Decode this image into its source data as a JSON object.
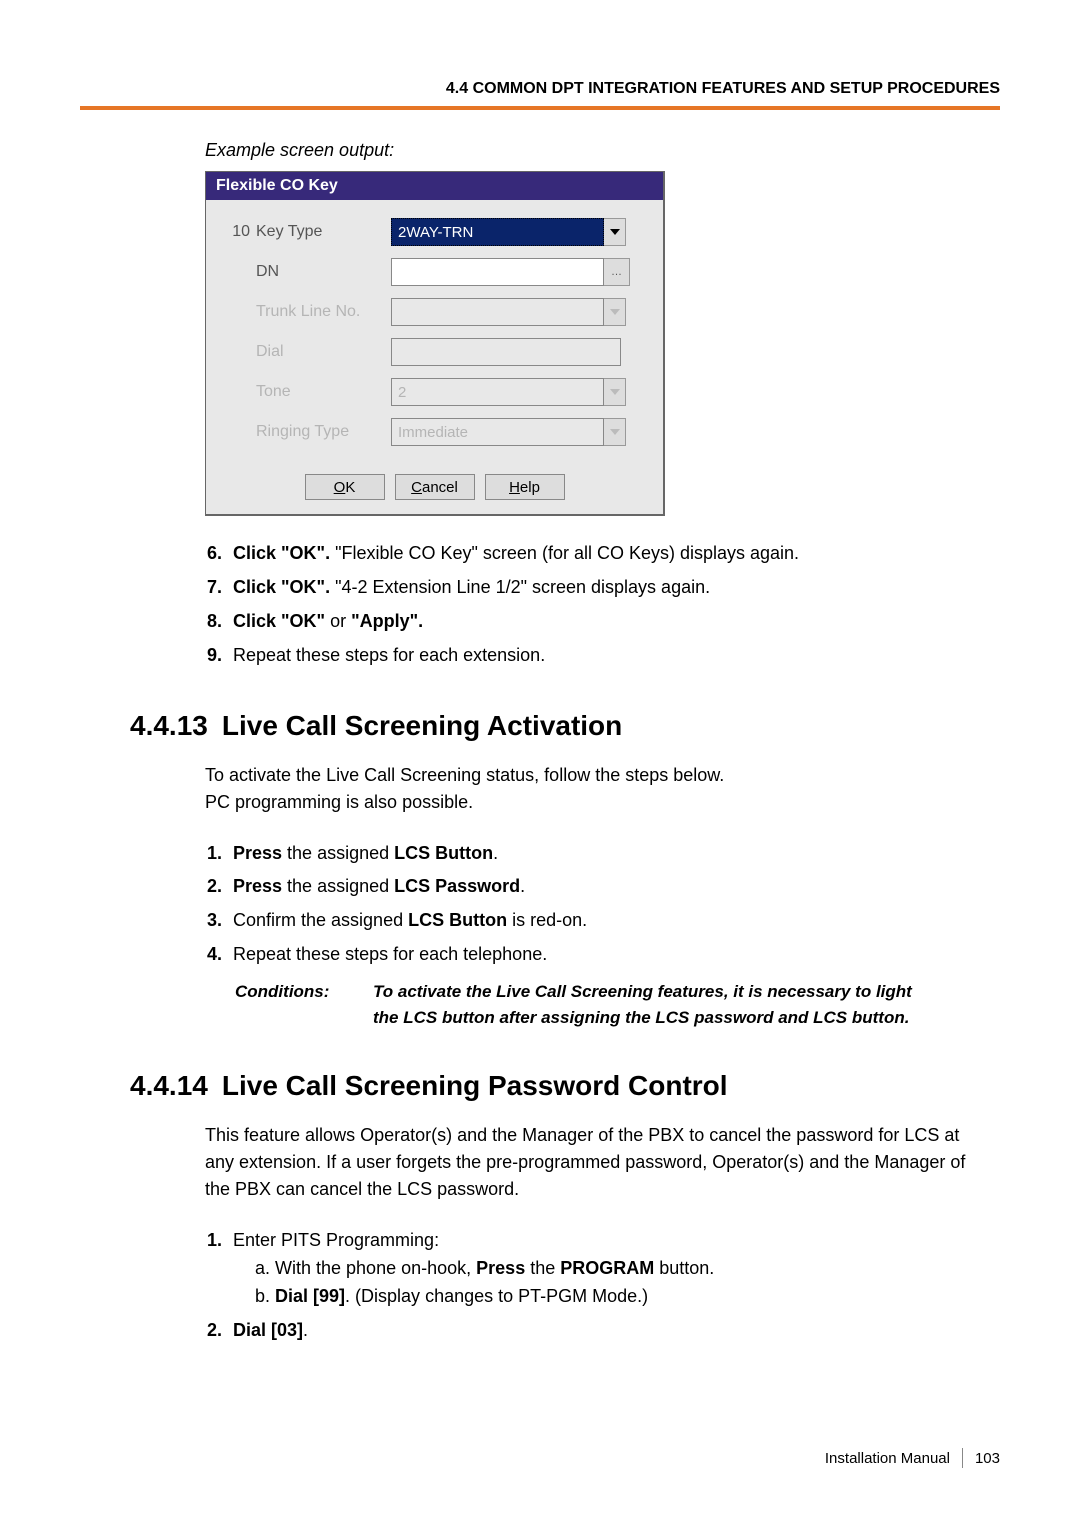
{
  "header": {
    "title": "4.4 COMMON DPT INTEGRATION FEATURES AND SETUP PROCEDURES"
  },
  "caption": "Example screen output:",
  "dialog": {
    "title": "Flexible CO Key",
    "rows": {
      "keytype": {
        "num": "10",
        "label": "Key Type",
        "value": "2WAY-TRN"
      },
      "dn": {
        "label": "DN",
        "value": ""
      },
      "trunk": {
        "label": "Trunk Line No.",
        "value": ""
      },
      "dial": {
        "label": "Dial",
        "value": ""
      },
      "tone": {
        "label": "Tone",
        "value": "2"
      },
      "ringing": {
        "label": "Ringing Type",
        "value": "Immediate"
      }
    },
    "buttons": {
      "ok": "OK",
      "cancel": "Cancel",
      "help": "Help"
    }
  },
  "steps_a": {
    "s6": {
      "bold": "Click \"OK\".",
      "rest": " \"Flexible CO Key\" screen (for all CO Keys) displays again."
    },
    "s7": {
      "bold": "Click \"OK\".",
      "rest": " \"4-2 Extension Line 1/2\" screen displays again."
    },
    "s8": {
      "bold1": "Click \"OK\"",
      "mid": " or ",
      "bold2": "\"Apply\"."
    },
    "s9": "Repeat these steps for each extension."
  },
  "section413": {
    "num": "4.4.13",
    "title": "Live Call Screening Activation",
    "intro1": "To activate the Live Call Screening status, follow the steps below.",
    "intro2": "PC programming is also possible.",
    "steps": {
      "s1": {
        "b1": "Press",
        "mid": " the assigned ",
        "b2": "LCS Button",
        "end": "."
      },
      "s2": {
        "b1": "Press",
        "mid": " the assigned ",
        "b2": "LCS Password",
        "end": "."
      },
      "s3": {
        "pre": "Confirm the assigned ",
        "b1": "LCS Button",
        "end": " is red-on."
      },
      "s4": "Repeat these steps for each telephone."
    },
    "cond_label": "Conditions:",
    "cond_text": "To activate the Live Call Screening features, it is necessary to light the LCS button after assigning the LCS password and LCS button."
  },
  "section414": {
    "num": "4.4.14",
    "title": "Live Call Screening Password Control",
    "intro": "This feature allows Operator(s) and the Manager of the PBX to cancel the password for LCS at any extension. If a user forgets the pre-programmed password, Operator(s) and the Manager of the PBX can cancel the LCS password.",
    "steps": {
      "s1": "Enter PITS Programming:",
      "s1a_pre": "a. With the phone on-hook, ",
      "s1a_b1": "Press",
      "s1a_mid": " the ",
      "s1a_b2": "PROGRAM",
      "s1a_end": " button.",
      "s1b_pre": "b. ",
      "s1b_b1": "Dial [99]",
      "s1b_end": ". (Display changes to PT-PGM Mode.)",
      "s2_b1": "Dial [03]",
      "s2_end": "."
    }
  },
  "footer": {
    "doc": "Installation Manual",
    "page": "103"
  }
}
